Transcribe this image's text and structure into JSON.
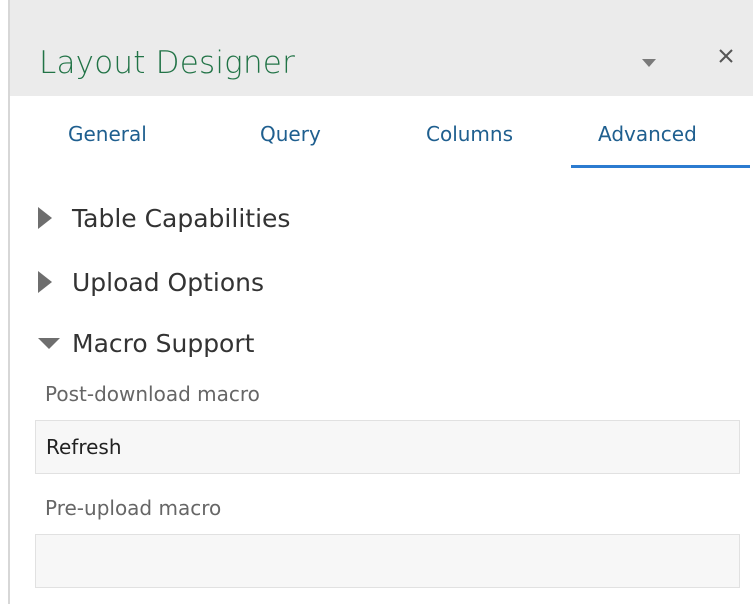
{
  "pane": {
    "title": "Layout Designer",
    "accent_color": "#217346",
    "icons": {
      "dropdown": "chevron-down-icon",
      "close": "close-icon"
    }
  },
  "tabs": {
    "items": [
      {
        "label": "General",
        "selected": false
      },
      {
        "label": "Query",
        "selected": false
      },
      {
        "label": "Columns",
        "selected": false
      },
      {
        "label": "Advanced",
        "selected": true
      }
    ],
    "tab_color": "#1f5f8f",
    "selected_underline_color": "#2b7bd0"
  },
  "sections": {
    "table_capabilities": {
      "label": "Table Capabilities",
      "expanded": false
    },
    "upload_options": {
      "label": "Upload Options",
      "expanded": false
    },
    "macro_support": {
      "label": "Macro Support",
      "expanded": true
    }
  },
  "macro_support": {
    "post_download": {
      "label": "Post-download macro",
      "value": "Refresh"
    },
    "pre_upload": {
      "label": "Pre-upload macro",
      "value": ""
    }
  }
}
